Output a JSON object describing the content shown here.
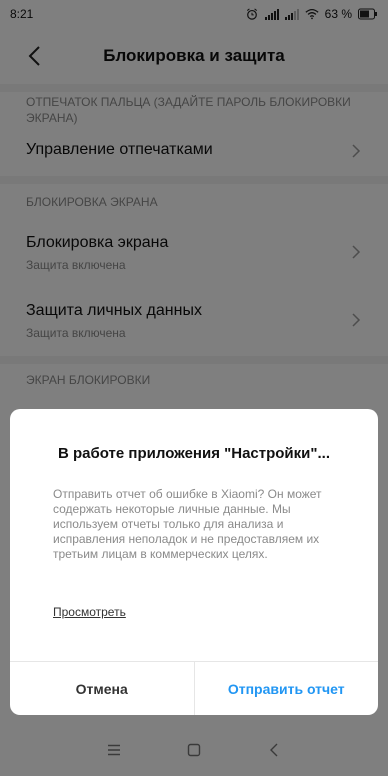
{
  "status_bar": {
    "time": "8:21",
    "battery": "63 %",
    "icons": [
      "alarm-icon",
      "signal-icon",
      "signal-icon",
      "wifi-icon",
      "battery-icon"
    ]
  },
  "header": {
    "title": "Блокировка и защита",
    "back_icon": "back-arrow-icon"
  },
  "sections": [
    {
      "label": "ОТПЕЧАТОК ПАЛЬЦА (ЗАДАЙТЕ ПАРОЛЬ БЛОКИРОВКИ ЭКРАНА)",
      "items": [
        {
          "title": "Управление отпечатками",
          "subtitle": ""
        }
      ]
    },
    {
      "label": "БЛОКИРОВКА ЭКРАНА",
      "items": [
        {
          "title": "Блокировка экрана",
          "subtitle": "Защита включена"
        },
        {
          "title": "Защита личных данных",
          "subtitle": "Защита включена"
        }
      ]
    },
    {
      "label": "ЭКРАН БЛОКИРОВКИ",
      "items": []
    }
  ],
  "dialog": {
    "title": "В работе приложения \"Настройки\"...",
    "body": "Отправить отчет об ошибке в Xiaomi? Он может содержать некоторые личные данные. Мы используем отчеты только для анализа и исправления неполадок и не предоставляем их третьим лицам в коммерческих целях.",
    "link": "Просмотреть",
    "cancel_label": "Отмена",
    "send_label": "Отправить отчет",
    "accent_color": "#2196f3"
  },
  "nav_bar": {
    "icons": [
      "menu-icon",
      "home-icon",
      "back-icon"
    ]
  }
}
